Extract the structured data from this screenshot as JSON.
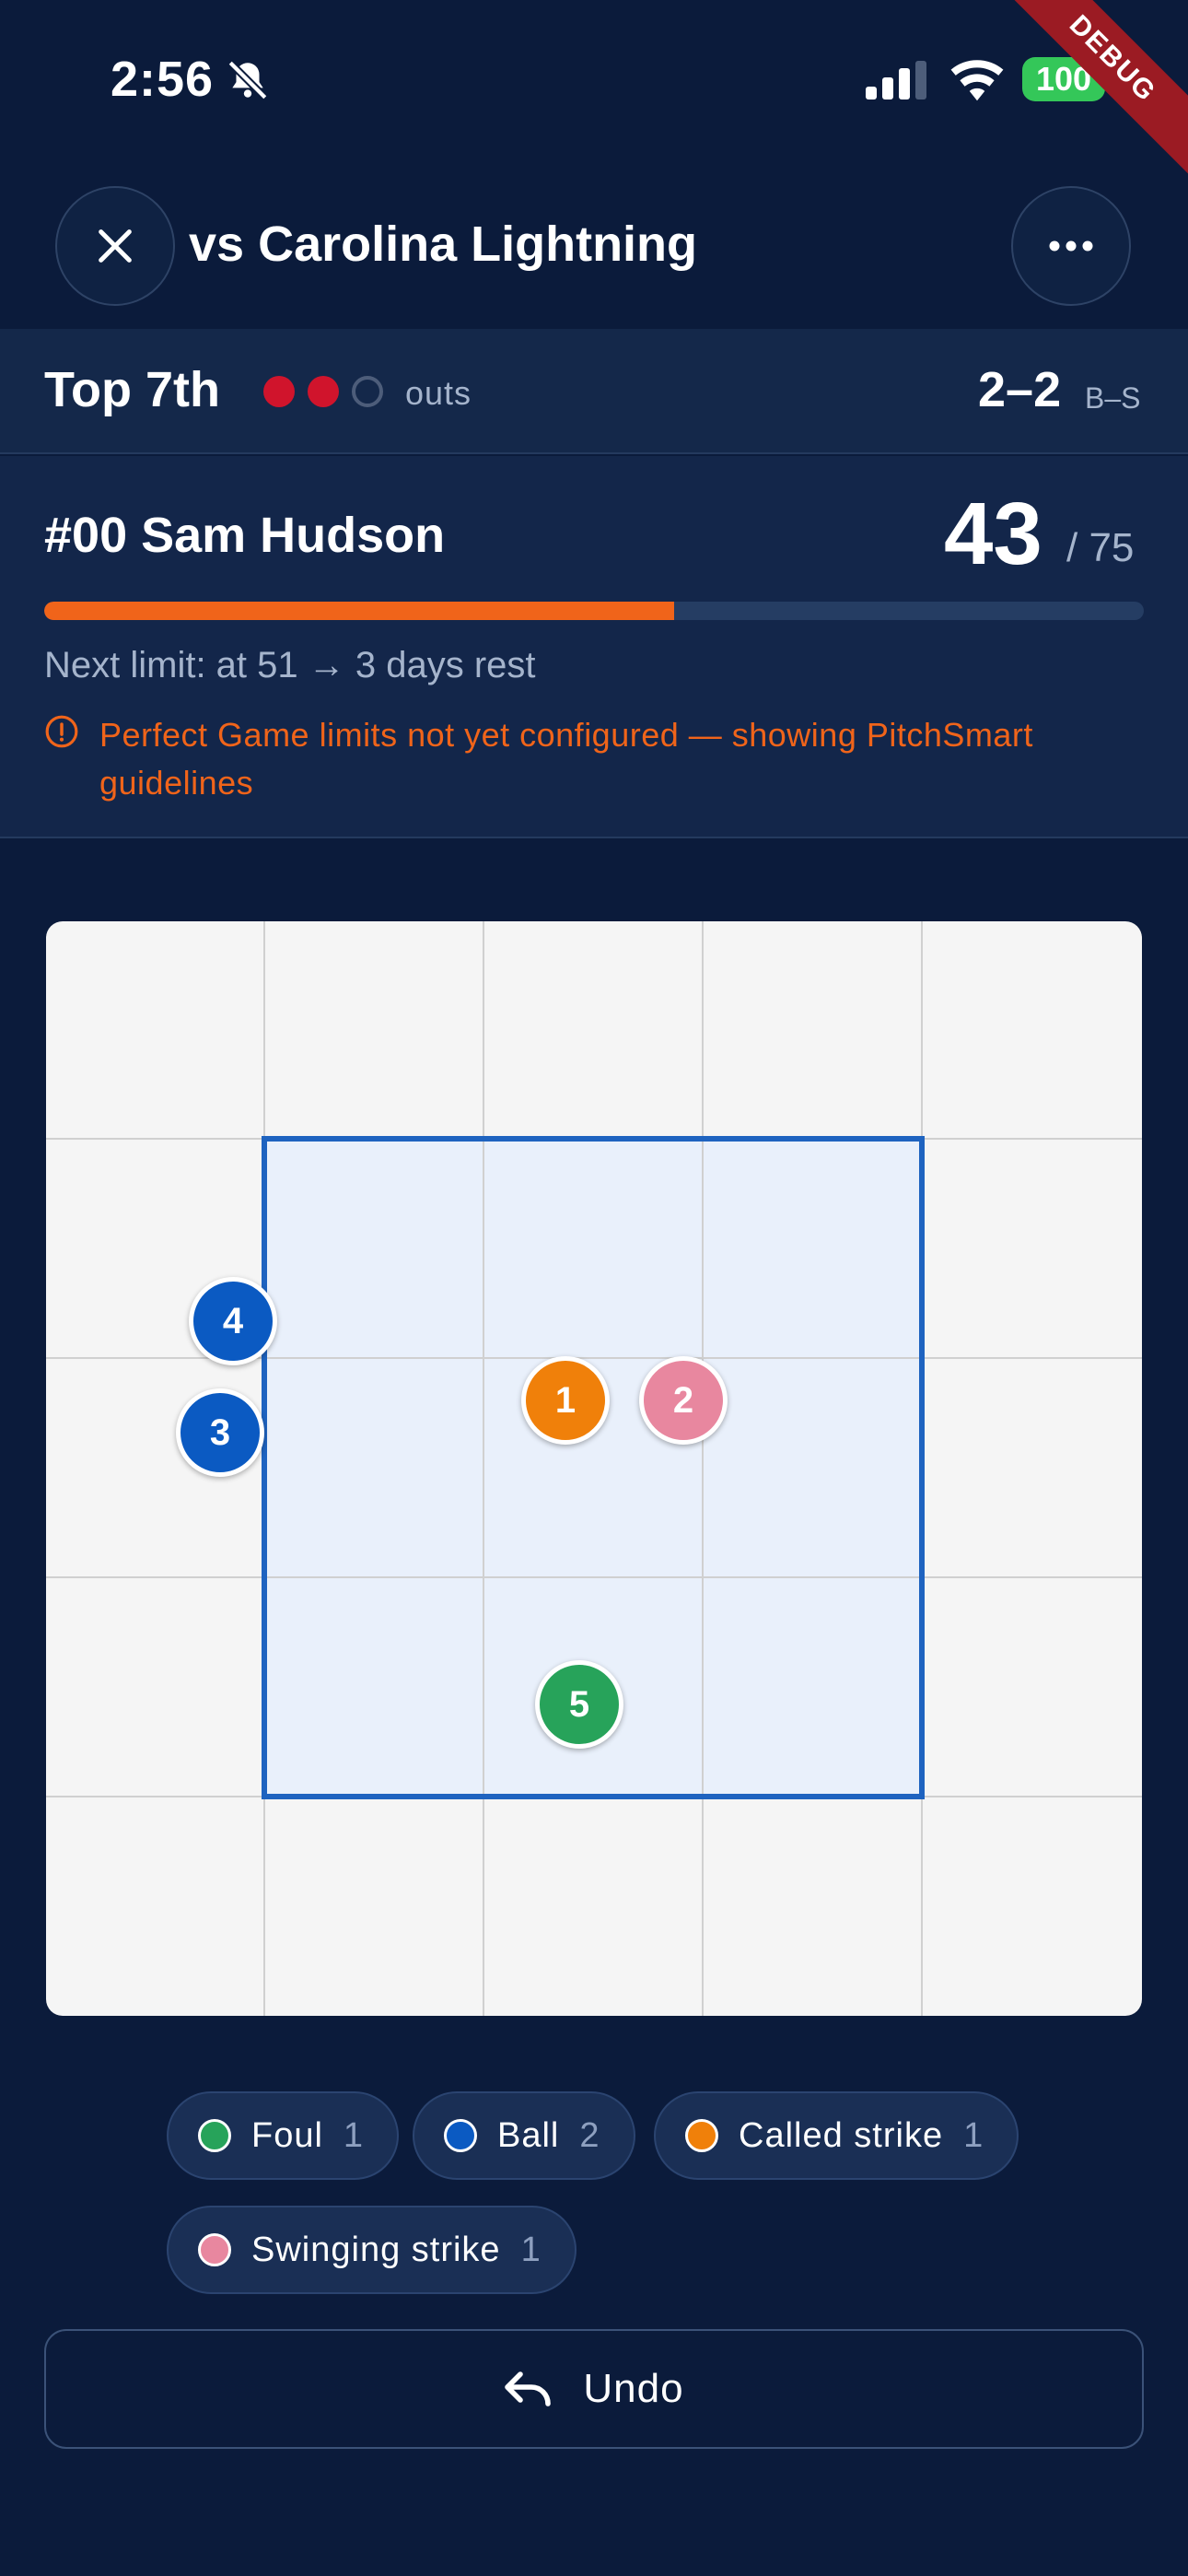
{
  "status_bar": {
    "time": "2:56",
    "battery": "100",
    "debug_label": "DEBUG",
    "icons": [
      "bell-slash-icon",
      "signal-icon",
      "wifi-icon"
    ]
  },
  "header": {
    "title": "vs Carolina Lightning",
    "close_icon": "close-icon",
    "more_icon": "more-horizontal-icon"
  },
  "inning": {
    "label": "Top 7th",
    "outs_label": "outs",
    "outs": 2,
    "outs_max": 3,
    "count": "2–2",
    "count_label": "B–S"
  },
  "pitcher": {
    "name": "#00 Sam Hudson",
    "pitch_count": "43",
    "limit": "/ 75",
    "progress": 0.573,
    "next_limit": "Next limit: at 51 → 3 days rest",
    "warning": "Perfect Game limits not yet configured — showing PitchSmart guidelines"
  },
  "pitches": [
    {
      "number": "1",
      "type": "Called strike"
    },
    {
      "number": "2",
      "type": "Swinging strike"
    },
    {
      "number": "3",
      "type": "Ball"
    },
    {
      "number": "4",
      "type": "Ball"
    },
    {
      "number": "5",
      "type": "Foul"
    }
  ],
  "legend": [
    {
      "label": "Foul",
      "count": "1",
      "color": "#27a35a"
    },
    {
      "label": "Ball",
      "count": "2",
      "color": "#0b5ac2"
    },
    {
      "label": "Called strike",
      "count": "1",
      "color": "#f0800a"
    },
    {
      "label": "Swinging strike",
      "count": "1",
      "color": "#e8879f"
    }
  ],
  "colors": {
    "background": "#0b1b3b",
    "accent": "#f0641a",
    "out_filled": "#d0142c",
    "zone_border": "#1e63c0"
  },
  "undo": {
    "label": "Undo"
  }
}
